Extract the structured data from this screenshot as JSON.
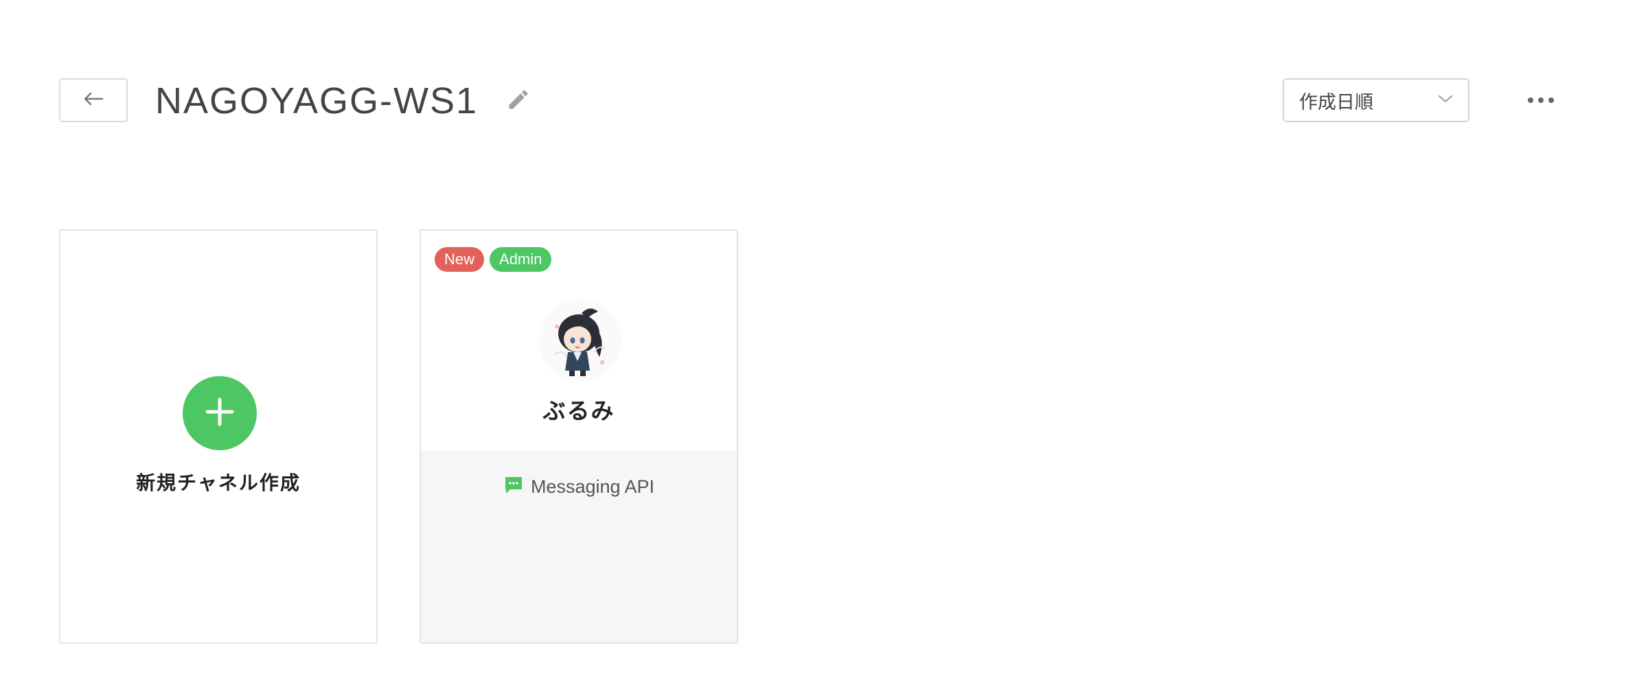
{
  "header": {
    "title": "NAGOYAGG-WS1",
    "sort": {
      "selected": "作成日順"
    }
  },
  "new_channel": {
    "label": "新規チャネル作成"
  },
  "channels": [
    {
      "name": "ぶるみ",
      "badges": [
        "New",
        "Admin"
      ],
      "type": "Messaging API"
    }
  ],
  "colors": {
    "accent_green": "#4cc764",
    "badge_new_red": "#e2615a",
    "card_bottom_bg": "#f5f6f7"
  },
  "icons": {
    "back": "arrow-left-icon",
    "edit": "pencil-icon",
    "sort": "chevron-down-icon",
    "more": "ellipsis-icon",
    "add": "plus-icon",
    "api": "chat-bubble-icon"
  }
}
